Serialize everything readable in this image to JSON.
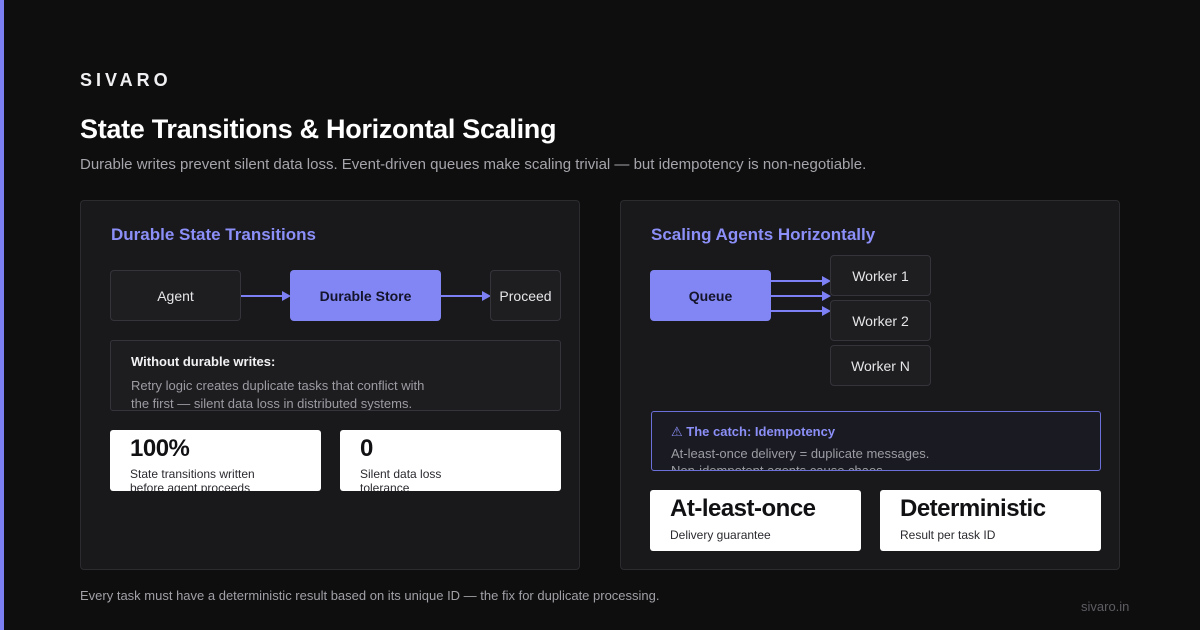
{
  "brand": "SIVARO",
  "title": "State Transitions & Horizontal Scaling",
  "subtitle": "Durable writes prevent silent data loss. Event-driven queues make scaling trivial — but idempotency is non-negotiable.",
  "colors": {
    "background": "#0e0e0f",
    "accent": "#7b7ff2",
    "panel": "#19191c",
    "stat_card": "#ffffff"
  },
  "left_panel": {
    "title": "Durable State Transitions",
    "flow": {
      "agent": "Agent",
      "store": "Durable Store",
      "proceed": "Proceed"
    },
    "callout": {
      "heading": "Without durable writes:",
      "line1": "Retry logic creates duplicate tasks that conflict with",
      "line2": "the first — silent data loss in distributed systems."
    },
    "stats": [
      {
        "value": "100%",
        "line1": "State transitions written",
        "line2": "before agent proceeds"
      },
      {
        "value": "0",
        "line1": "Silent data loss",
        "line2": "tolerance"
      }
    ]
  },
  "right_panel": {
    "title": "Scaling Agents Horizontally",
    "queue": "Queue",
    "workers": [
      "Worker 1",
      "Worker 2",
      "Worker N"
    ],
    "catch": {
      "icon": "warning-icon",
      "heading": "⚠ The catch: Idempotency",
      "line1": "At-least-once delivery = duplicate messages.",
      "line2": "Non-idempotent agents cause chaos."
    },
    "stats": [
      {
        "value": "At-least-once",
        "label": "Delivery guarantee"
      },
      {
        "value": "Deterministic",
        "label": "Result per task ID"
      }
    ]
  },
  "footer": {
    "note": "Every task must have a deterministic result based on its unique ID — the fix for duplicate processing.",
    "url": "sivaro.in"
  }
}
